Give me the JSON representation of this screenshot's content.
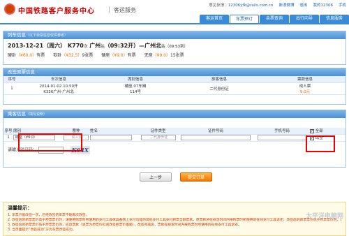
{
  "header": {
    "logo_text": "中国铁路客户服务中心",
    "logo_sub": "客运服务",
    "topbar": {
      "feedback_label": "意见反馈：",
      "feedback_email": "12306yfk@rails.com.cn",
      "weibo": "新浪微博",
      "logout": "退出",
      "user": "我的12306",
      "mobile": "手机"
    },
    "nav_tabs": [
      "客运首页",
      "车票预订",
      "余票查询",
      "出行向导",
      "信息服务"
    ]
  },
  "train_info": {
    "title": "列车信息",
    "title_note": "（以下余票信息仅供参考）",
    "date": "2013-12-21（周六）",
    "train_no": "K770",
    "train_no_suffix": "次",
    "from_station": "广州",
    "from_suffix": "站",
    "depart_time": "（09:32开）",
    "arrow": "—",
    "to_station": "广州北",
    "to_suffix": "站",
    "arrive_time": "（09:53到）",
    "seats": [
      {
        "name": "硬卧",
        "price": "（¥60.0）",
        "count": "有票"
      },
      {
        "name": "软卧",
        "price": "（¥32.5）",
        "count": "9张票"
      },
      {
        "name": "硬座",
        "price": "（¥9.0）",
        "count": "有票"
      },
      {
        "name": "无座",
        "price": "（¥9.0）",
        "count": "15张票"
      }
    ]
  },
  "change_info": {
    "title": "改签原票信息",
    "headers": [
      "序号",
      "车次信息",
      "席别信息",
      "旅客信息",
      "票款信息"
    ],
    "row": {
      "index": "1",
      "train_line1": "2014-01-02 10:59开",
      "train_line2": "K326广州-广州北",
      "seat_line1": "硬座 07车厢",
      "seat_line2": "114号",
      "passenger_line1": "",
      "passenger_line2": "二代身份证",
      "price_line1": "成人票",
      "price_line2": "9.0元"
    }
  },
  "passenger_info": {
    "title": "乘客信息",
    "title_note": "（填写说明）",
    "headers": [
      "序号",
      "席别",
      "票种",
      "姓名",
      "证件类型",
      "证件号码",
      "手机号码",
      "全部"
    ],
    "row": {
      "index": "1",
      "seat_select": "硬座（¥9.0）",
      "ticket_type": "成人票",
      "name": "",
      "id_type": "二代身份证",
      "id_number": "",
      "phone": "",
      "change_label": "改签"
    },
    "captcha_label": "请输入验证码：",
    "captcha_value": "",
    "captcha_image_text": "K64X"
  },
  "buttons": {
    "prev": "上一步",
    "submit": "提交订单"
  },
  "tips": {
    "title": "温馨提示：",
    "lines": [
      "1. 车票只能改签一次，已经改签的车票不能再次改签。",
      "2. 改签后的新票票价高于原票票价时，请使用购票时所使用的支付工具或具备网上支付功能的其他支付工具支付新票全额票款，原票款将在规定时间内按购票时所使用的在线支付工具退还；改签后的新票票价低于原票票价时，退还差额。",
      "3. 改签后的新票票价低于原票票价的，应退票款（退票为原票价扣减改签新票价差额），改签完成后，票款在规定时间内按购票时所使用的在线支付工具退还。",
      "3. 当页面提示“改签成功”方为车票改签成功。"
    ]
  },
  "watermark": "太平洋电脑网",
  "colors": {
    "brand_red": "#cc0000",
    "nav_blue": "#3a8ad8",
    "price_orange": "#ff6600",
    "highlight_red": "#ee0000"
  }
}
